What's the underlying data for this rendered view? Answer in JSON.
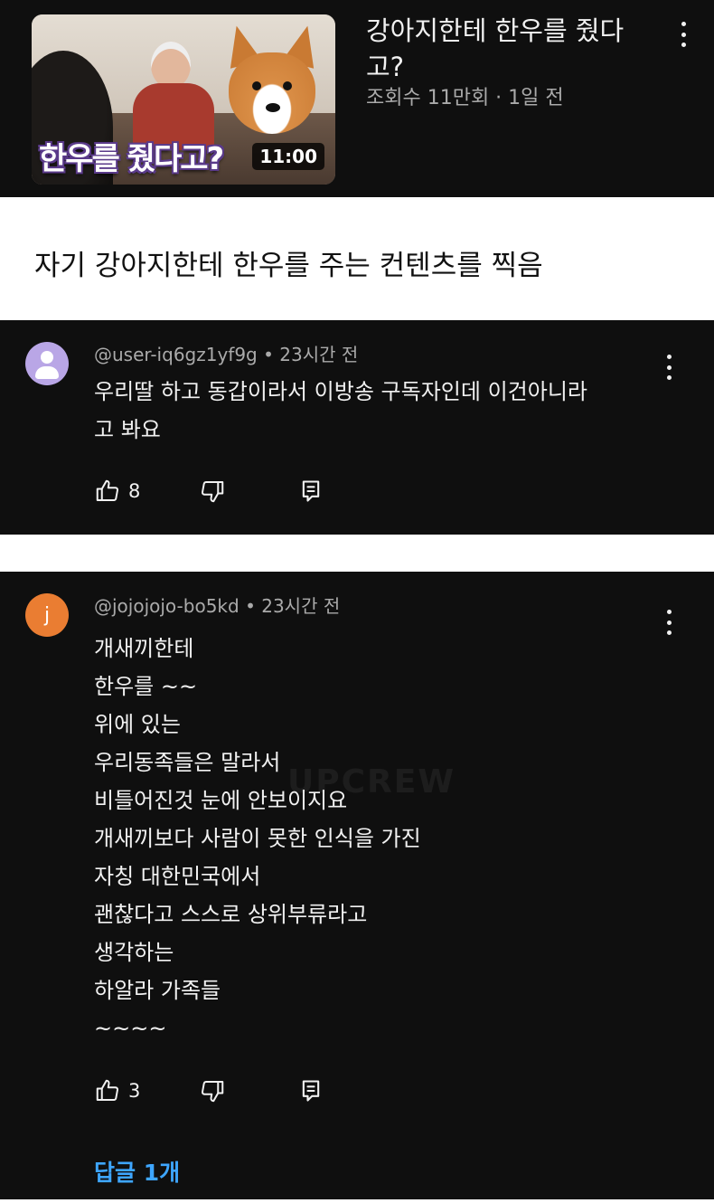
{
  "video": {
    "title": "강아지한테 한우를 줬다고?",
    "meta": "조회수 11만회 · 1일 전",
    "duration": "11:00",
    "thumbnail_caption": "한우를 줬다고?",
    "menu_icon": "more-vert-icon"
  },
  "caption": "자기 강아지한테 한우를 주는 컨텐츠를 찍음",
  "comments": [
    {
      "author": "@user-iq6gz1yf9g",
      "time": "23시간 전",
      "avatar_type": "default-person",
      "avatar_color": "#b9a6e6",
      "lines": [
        "우리딸 하고 동갑이라서 이방송 구독자인데 이건아니라",
        "고 봐요"
      ],
      "likes": "8"
    },
    {
      "author": "@jojojojo-bo5kd",
      "time": "23시간 전",
      "avatar_letter": "j",
      "avatar_color": "#ea7d32",
      "lines": [
        "개새끼한테",
        "한우를 ~~",
        "위에 있는",
        "우리동족들은 말라서",
        "비틀어진것 눈에 안보이지요",
        "개새끼보다 사람이 못한 인식을 가진",
        "자칭 대한민국에서",
        "괜찮다고 스스로 상위부류라고",
        "생각하는",
        "하알라 가족들",
        "~~~~"
      ],
      "likes": "3",
      "replies": "답글 1개"
    }
  ],
  "icons": {
    "like": "thumb-up-icon",
    "dislike": "thumb-down-icon",
    "reply": "comment-reply-icon",
    "more": "more-vert-icon"
  },
  "watermark": "UPCREW",
  "colors": {
    "panel_bg": "#0f0f0f",
    "text": "#f1f1f1",
    "meta": "#aaaaaa",
    "link": "#3ea6ff"
  }
}
